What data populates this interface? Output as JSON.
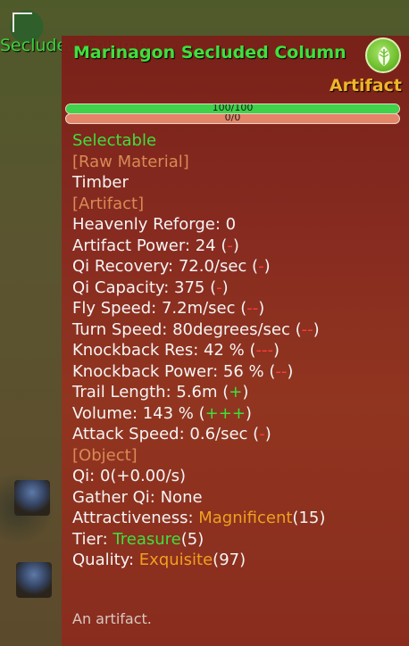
{
  "map": {
    "label": "Secluded Column"
  },
  "tooltip": {
    "title": "Marinagon Secluded Column",
    "rarity": "Artifact",
    "badge_icon": "leaf-icon",
    "hp_bar": {
      "text": "100/100",
      "fraction": 1.0
    },
    "qi_bar": {
      "text": "0/0",
      "fraction": 0.0
    },
    "selectable": "Selectable",
    "raw_header": "[Raw Material]",
    "raw_value": "Timber",
    "artifact_header": "[Artifact]",
    "stats": {
      "reforge": "Heavenly Reforge: 0",
      "power": "Artifact Power: 24 ",
      "power_mod": "-",
      "qi_recovery": "Qi Recovery: 72.0/sec ",
      "qi_recovery_mod": "-",
      "qi_capacity": "Qi Capacity: 375 ",
      "qi_capacity_mod": "-",
      "fly_speed": "Fly Speed: 7.2m/sec ",
      "fly_speed_mod": "--",
      "turn_speed": "Turn Speed: 80degrees/sec ",
      "turn_speed_mod": "--",
      "kb_res": "Knockback Res: 42 % ",
      "kb_res_mod": "---",
      "kb_power": "Knockback Power: 56 % ",
      "kb_power_mod": "--",
      "trail": "Trail Length: 5.6m ",
      "trail_mod": "+",
      "volume": "Volume: 143 % ",
      "volume_mod": "+++",
      "attack_speed": "Attack Speed: 0.6/sec ",
      "attack_speed_mod": "-"
    },
    "object_header": "[Object]",
    "object": {
      "qi": "Qi: 0(+0.00/s)",
      "gather": "Gather Qi: None",
      "attr_label": "Attractiveness: ",
      "attr_value": "Magnificent",
      "attr_num": "(15)",
      "tier_label": "Tier: ",
      "tier_value": "Treasure",
      "tier_num": "(5)",
      "quality_label": "Quality: ",
      "quality_value": "Exquisite",
      "quality_num": "(97)"
    },
    "description": "An artifact."
  },
  "colors": {
    "title_green": "#3ee03e",
    "rarity_gold": "#f0b429",
    "section_orange": "#d98a55",
    "mod_red": "#ff3b3b",
    "value_orange": "#f0a020"
  }
}
